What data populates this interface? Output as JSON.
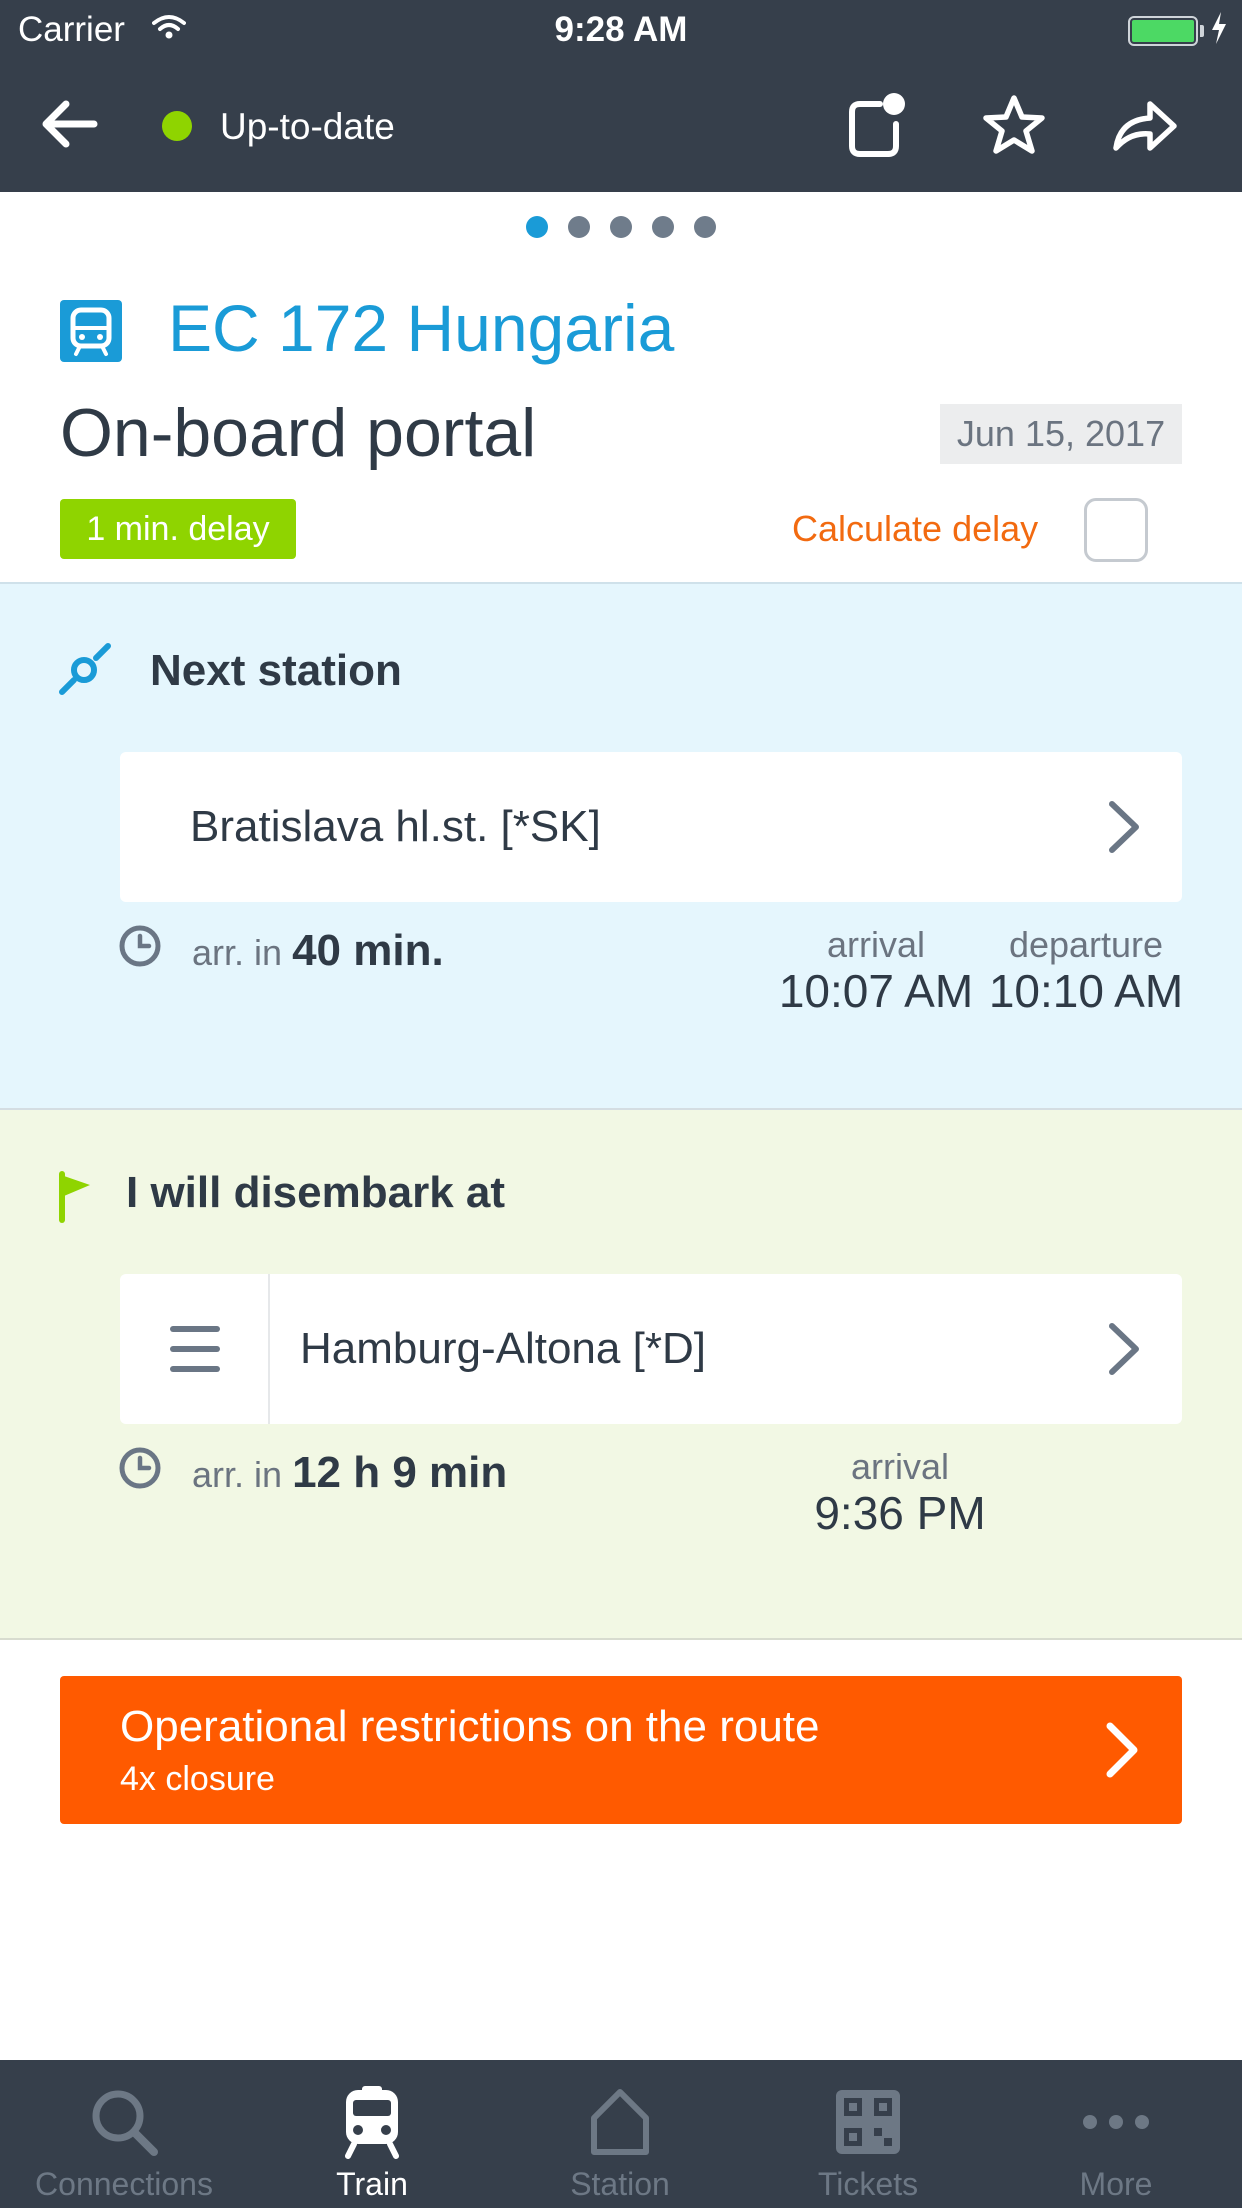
{
  "status_bar": {
    "carrier": "Carrier",
    "time": "9:28 AM"
  },
  "nav": {
    "status_text": "Up-to-date",
    "status_color": "#8fd400"
  },
  "pager": {
    "count": 5,
    "active": 1
  },
  "header": {
    "train_name": "EC 172 Hungaria",
    "subtitle": "On-board portal",
    "date": "Jun 15, 2017",
    "delay_badge": "1 min. delay",
    "calculate_delay": "Calculate delay"
  },
  "next_station": {
    "title": "Next station",
    "station": "Bratislava hl.st. [*SK]",
    "arr_prefix": "arr. in",
    "arr_in": "40 min.",
    "arrival_label": "arrival",
    "arrival": "10:07 AM",
    "departure_label": "departure",
    "departure": "10:10 AM"
  },
  "disembark": {
    "title": "I will disembark at",
    "station": "Hamburg-Altona [*D]",
    "arr_prefix": "arr. in",
    "arr_in": "12 h 9 min",
    "arrival_label": "arrival",
    "arrival": "9:36 PM"
  },
  "restrictions": {
    "title": "Operational restrictions on the route",
    "subtitle": "4x closure",
    "color": "#ff5a00"
  },
  "tabs": [
    {
      "label": "Connections",
      "icon": "search-icon",
      "active": false
    },
    {
      "label": "Train",
      "icon": "train-icon",
      "active": true
    },
    {
      "label": "Station",
      "icon": "house-icon",
      "active": false
    },
    {
      "label": "Tickets",
      "icon": "qr-code-icon",
      "active": false
    },
    {
      "label": "More",
      "icon": "more-dots-icon",
      "active": false
    }
  ],
  "colors": {
    "accent": "#1a9bd7",
    "nav_bg": "#363f4b",
    "delay_green": "#8fd400",
    "calc_orange": "#f26a10"
  }
}
